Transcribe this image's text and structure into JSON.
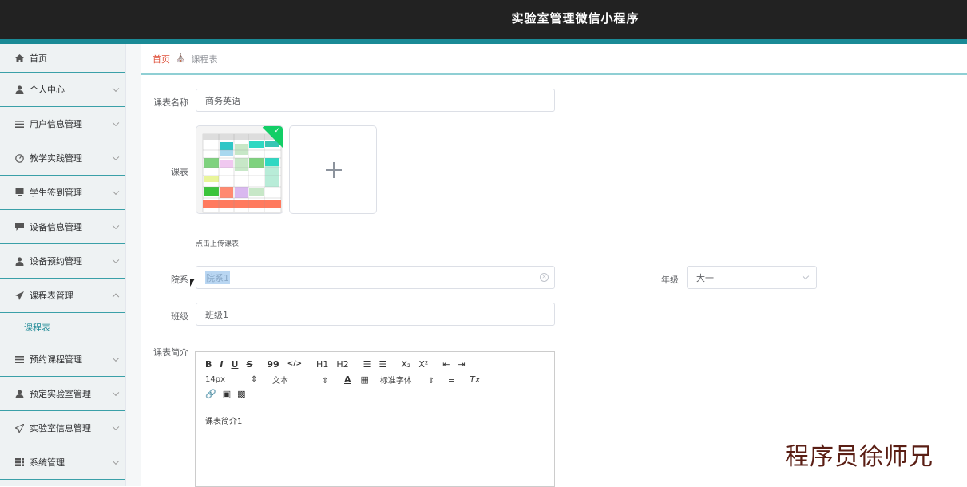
{
  "app": {
    "title": "实验室管理微信小程序"
  },
  "sidebar": {
    "items": [
      {
        "label": "首页",
        "icon": "home-icon"
      },
      {
        "label": "个人中心",
        "icon": "user-icon"
      },
      {
        "label": "用户信息管理",
        "icon": "list-icon"
      },
      {
        "label": "教学实践管理",
        "icon": "gauge-icon"
      },
      {
        "label": "学生签到管理",
        "icon": "monitor-icon"
      },
      {
        "label": "设备信息管理",
        "icon": "chat-icon"
      },
      {
        "label": "设备预约管理",
        "icon": "user-icon"
      },
      {
        "label": "课程表管理",
        "icon": "send-icon"
      },
      {
        "label": "课程表",
        "icon": ""
      },
      {
        "label": "预约课程管理",
        "icon": "list-icon"
      },
      {
        "label": "预定实验室管理",
        "icon": "user-icon"
      },
      {
        "label": "实验室信息管理",
        "icon": "send-icon"
      },
      {
        "label": "系统管理",
        "icon": "grid-icon"
      }
    ]
  },
  "breadcrumb": {
    "home": "首页",
    "current": "课程表"
  },
  "form": {
    "course_name_label": "课表名称",
    "course_name_value": "商务英语",
    "schedule_label": "课表",
    "upload_hint": "点击上传课表",
    "dept_label": "院系",
    "dept_value": "院系1",
    "grade_label": "年级",
    "grade_value": "大一",
    "class_label": "班级",
    "class_value": "班级1",
    "intro_label": "课表简介"
  },
  "editor": {
    "font_size": "14px",
    "text_style": "文本",
    "font_family": "标准字体",
    "content": "课表简介1",
    "h1": "H1",
    "h2": "H2",
    "bold": "B",
    "italic": "I",
    "underline": "U",
    "strike": "S",
    "quote": "99",
    "code": "</>",
    "sub": "X₂",
    "sup": "X²",
    "color_a": "A",
    "clear": "Tx"
  },
  "watermark": "程序员徐师兄",
  "colors": {
    "topbar": "#222222",
    "accent": "#1a8a96",
    "breadcrumb_home": "#e0533d",
    "success": "#13ce66"
  }
}
